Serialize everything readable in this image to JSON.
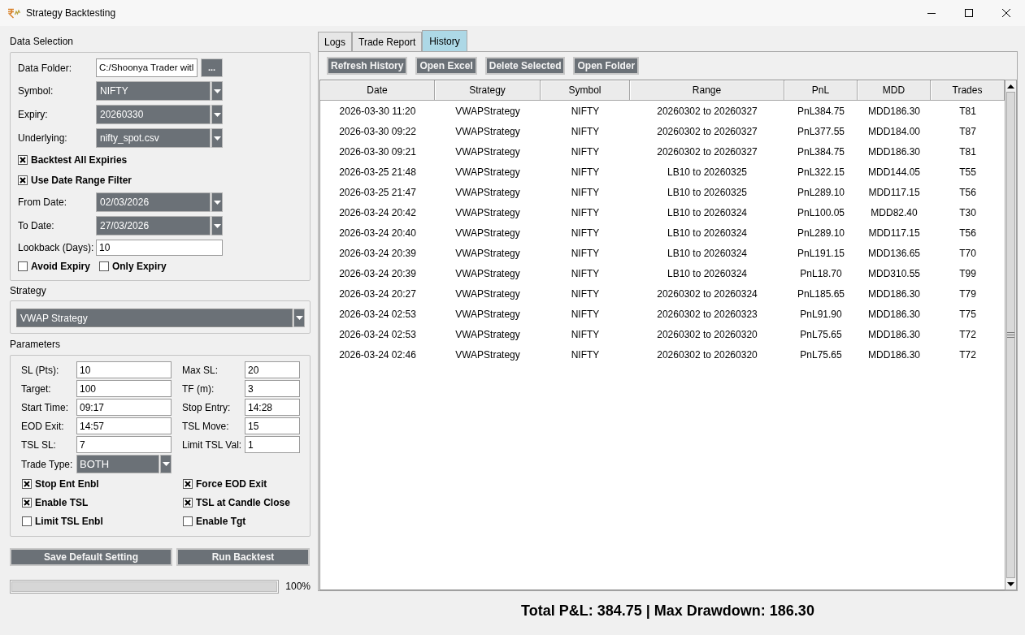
{
  "window": {
    "title": "Strategy Backtesting"
  },
  "data_selection": {
    "title": "Data Selection",
    "rows": [
      {
        "kind": "path",
        "label": "Data Folder:",
        "value": "C:/Shoonya Trader witl",
        "button": "..."
      },
      {
        "kind": "combo",
        "label": "Symbol:",
        "value": "NIFTY"
      },
      {
        "kind": "combo",
        "label": "Expiry:",
        "value": "20260330"
      },
      {
        "kind": "combo",
        "label": "Underlying:",
        "value": "nifty_spot.csv"
      },
      {
        "kind": "check",
        "label": "Backtest All Expiries",
        "checked": true
      },
      {
        "kind": "check",
        "label": "Use Date Range Filter",
        "checked": true
      },
      {
        "kind": "combo",
        "label": "From Date:",
        "value": "02/03/2026"
      },
      {
        "kind": "combo",
        "label": "To Date:",
        "value": "27/03/2026"
      },
      {
        "kind": "input",
        "label": "Lookback (Days):",
        "value": "10"
      },
      {
        "kind": "checks",
        "items": [
          {
            "label": "Avoid Expiry",
            "checked": false
          },
          {
            "label": "Only Expiry",
            "checked": false
          }
        ]
      }
    ]
  },
  "strategy": {
    "title": "Strategy",
    "value": "VWAP Strategy"
  },
  "parameters": {
    "title": "Parameters",
    "fields": [
      {
        "kind": "input",
        "label": "SL (Pts):",
        "value": "10"
      },
      {
        "kind": "input",
        "label": "Max SL:",
        "value": "20"
      },
      {
        "kind": "input",
        "label": "Target:",
        "value": "100"
      },
      {
        "kind": "input",
        "label": "TF (m):",
        "value": "3"
      },
      {
        "kind": "input",
        "label": "Start Time:",
        "value": "09:17"
      },
      {
        "kind": "input",
        "label": "Stop Entry:",
        "value": "14:28"
      },
      {
        "kind": "input",
        "label": "EOD Exit:",
        "value": "14:57"
      },
      {
        "kind": "input",
        "label": "TSL Move:",
        "value": "15"
      },
      {
        "kind": "input",
        "label": "TSL SL:",
        "value": "7"
      },
      {
        "kind": "input",
        "label": "Limit TSL Val:",
        "value": "1"
      },
      {
        "kind": "combo",
        "label": "Trade Type:",
        "value": "BOTH"
      }
    ],
    "checks": [
      {
        "label": "Stop Ent Enbl",
        "checked": true
      },
      {
        "label": "Force EOD Exit",
        "checked": true
      },
      {
        "label": "Enable TSL",
        "checked": true
      },
      {
        "label": "TSL at Candle Close",
        "checked": true
      },
      {
        "label": "Limit TSL Enbl",
        "checked": false
      },
      {
        "label": "Enable Tgt",
        "checked": false
      }
    ]
  },
  "actions": [
    "Save Default Setting",
    "Run Backtest"
  ],
  "progress": {
    "level": 1,
    "reading": "100%"
  },
  "tabs": [
    {
      "label": "Logs",
      "selected": false
    },
    {
      "label": "Trade Report",
      "selected": false
    },
    {
      "label": "History",
      "selected": true
    }
  ],
  "history": {
    "buttons": [
      "Refresh History",
      "Open Excel",
      "Delete Selected",
      "Open Folder"
    ],
    "table": {
      "columns": [
        "Date",
        "Strategy",
        "Symbol",
        "Range",
        "PnL",
        "MDD",
        "Trades"
      ],
      "rows": [
        [
          "2026-03-30 11:20",
          "VWAPStrategy",
          "NIFTY",
          "20260302 to 20260327",
          "PnL384.75",
          "MDD186.30",
          "T81"
        ],
        [
          "2026-03-30 09:22",
          "VWAPStrategy",
          "NIFTY",
          "20260302 to 20260327",
          "PnL377.55",
          "MDD184.00",
          "T87"
        ],
        [
          "2026-03-30 09:21",
          "VWAPStrategy",
          "NIFTY",
          "20260302 to 20260327",
          "PnL384.75",
          "MDD186.30",
          "T81"
        ],
        [
          "2026-03-25 21:48",
          "VWAPStrategy",
          "NIFTY",
          "LB10 to 20260325",
          "PnL322.15",
          "MDD144.05",
          "T55"
        ],
        [
          "2026-03-25 21:47",
          "VWAPStrategy",
          "NIFTY",
          "LB10 to 20260325",
          "PnL289.10",
          "MDD117.15",
          "T56"
        ],
        [
          "2026-03-24 20:42",
          "VWAPStrategy",
          "NIFTY",
          "LB10 to 20260324",
          "PnL100.05",
          "MDD82.40",
          "T30"
        ],
        [
          "2026-03-24 20:40",
          "VWAPStrategy",
          "NIFTY",
          "LB10 to 20260324",
          "PnL289.10",
          "MDD117.15",
          "T56"
        ],
        [
          "2026-03-24 20:39",
          "VWAPStrategy",
          "NIFTY",
          "LB10 to 20260324",
          "PnL191.15",
          "MDD136.65",
          "T70"
        ],
        [
          "2026-03-24 20:39",
          "VWAPStrategy",
          "NIFTY",
          "LB10 to 20260324",
          "PnL18.70",
          "MDD310.55",
          "T99"
        ],
        [
          "2026-03-24 20:27",
          "VWAPStrategy",
          "NIFTY",
          "20260302 to 20260324",
          "PnL185.65",
          "MDD186.30",
          "T79"
        ],
        [
          "2026-03-24 02:53",
          "VWAPStrategy",
          "NIFTY",
          "20260302 to 20260323",
          "PnL91.90",
          "MDD186.30",
          "T75"
        ],
        [
          "2026-03-24 02:53",
          "VWAPStrategy",
          "NIFTY",
          "20260302 to 20260320",
          "PnL75.65",
          "MDD186.30",
          "T72"
        ],
        [
          "2026-03-24 02:46",
          "VWAPStrategy",
          "NIFTY",
          "20260302 to 20260320",
          "PnL75.65",
          "MDD186.30",
          "T72"
        ]
      ]
    }
  },
  "summary": "Total P&L: 384.75 | Max Drawdown: 186.30"
}
